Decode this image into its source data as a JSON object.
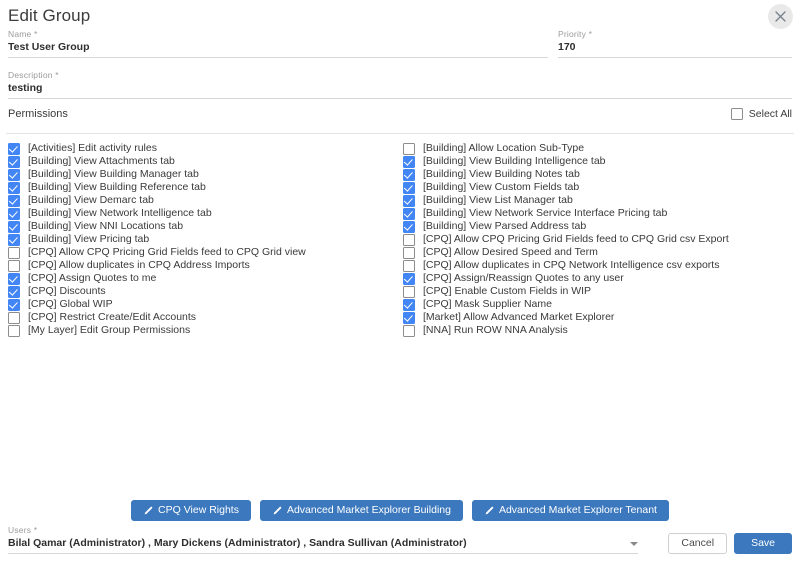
{
  "dialog": {
    "title": "Edit Group",
    "close_icon": "close-icon"
  },
  "fields": {
    "name": {
      "label": "Name *",
      "value": "Test User Group",
      "placeholder": "Name"
    },
    "priority": {
      "label": "Priority *",
      "value": "170",
      "placeholder": "Priority"
    },
    "description": {
      "label": "Description *",
      "value": "testing",
      "placeholder": "Description"
    },
    "users": {
      "label": "Users *",
      "value": "Bilal Qamar (Administrator) , Mary Dickens (Administrator) , Sandra Sullivan (Administrator)",
      "placeholder": "Users"
    }
  },
  "permissions_section": {
    "title": "Permissions",
    "select_all_label": "Select All",
    "select_all_checked": false
  },
  "permissions": {
    "left": [
      {
        "label": "[Activities] Edit activity rules",
        "checked": true
      },
      {
        "label": "[Building] View Attachments tab",
        "checked": true
      },
      {
        "label": "[Building] View Building Manager tab",
        "checked": true
      },
      {
        "label": "[Building] View Building Reference tab",
        "checked": true
      },
      {
        "label": "[Building] View Demarc tab",
        "checked": true
      },
      {
        "label": "[Building] View Network Intelligence tab",
        "checked": true
      },
      {
        "label": "[Building] View NNI Locations tab",
        "checked": true
      },
      {
        "label": "[Building] View Pricing tab",
        "checked": true
      },
      {
        "label": "[CPQ] Allow CPQ Pricing Grid Fields feed to CPQ Grid view",
        "checked": false
      },
      {
        "label": "[CPQ] Allow duplicates in CPQ Address Imports",
        "checked": false
      },
      {
        "label": "[CPQ] Assign Quotes to me",
        "checked": true
      },
      {
        "label": "[CPQ] Discounts",
        "checked": true
      },
      {
        "label": "[CPQ] Global WIP",
        "checked": true
      },
      {
        "label": "[CPQ] Restrict Create/Edit Accounts",
        "checked": false
      },
      {
        "label": "[My Layer] Edit Group Permissions",
        "checked": false
      }
    ],
    "right": [
      {
        "label": "[Building] Allow Location Sub-Type",
        "checked": false
      },
      {
        "label": "[Building] View Building Intelligence tab",
        "checked": true
      },
      {
        "label": "[Building] View Building Notes tab",
        "checked": true
      },
      {
        "label": "[Building] View Custom Fields tab",
        "checked": true
      },
      {
        "label": "[Building] View List Manager tab",
        "checked": true
      },
      {
        "label": "[Building] View Network Service Interface Pricing tab",
        "checked": true
      },
      {
        "label": "[Building] View Parsed Address tab",
        "checked": true
      },
      {
        "label": "[CPQ] Allow CPQ Pricing Grid Fields feed to CPQ Grid csv Export",
        "checked": false
      },
      {
        "label": "[CPQ] Allow Desired Speed and Term",
        "checked": false
      },
      {
        "label": "[CPQ] Allow duplicates in CPQ Network Intelligence csv exports",
        "checked": false
      },
      {
        "label": "[CPQ] Assign/Reassign Quotes to any user",
        "checked": true
      },
      {
        "label": "[CPQ] Enable Custom Fields in WIP",
        "checked": false
      },
      {
        "label": "[CPQ] Mask Supplier Name",
        "checked": true
      },
      {
        "label": "[Market] Allow Advanced Market Explorer",
        "checked": true
      },
      {
        "label": "[NNA] Run ROW NNA Analysis",
        "checked": false
      }
    ]
  },
  "action_buttons": [
    {
      "label": "CPQ View Rights",
      "icon": "pencil-icon"
    },
    {
      "label": "Advanced Market Explorer Building",
      "icon": "pencil-icon"
    },
    {
      "label": "Advanced Market Explorer Tenant",
      "icon": "pencil-icon"
    }
  ],
  "footer": {
    "cancel_label": "Cancel",
    "save_label": "Save"
  },
  "colors": {
    "primary_blue": "#3b78bd",
    "checkbox_blue": "#4285f4",
    "text": "#3a3a3a",
    "label_grey": "#9a9a9a",
    "divider": "#e4e4e4"
  }
}
